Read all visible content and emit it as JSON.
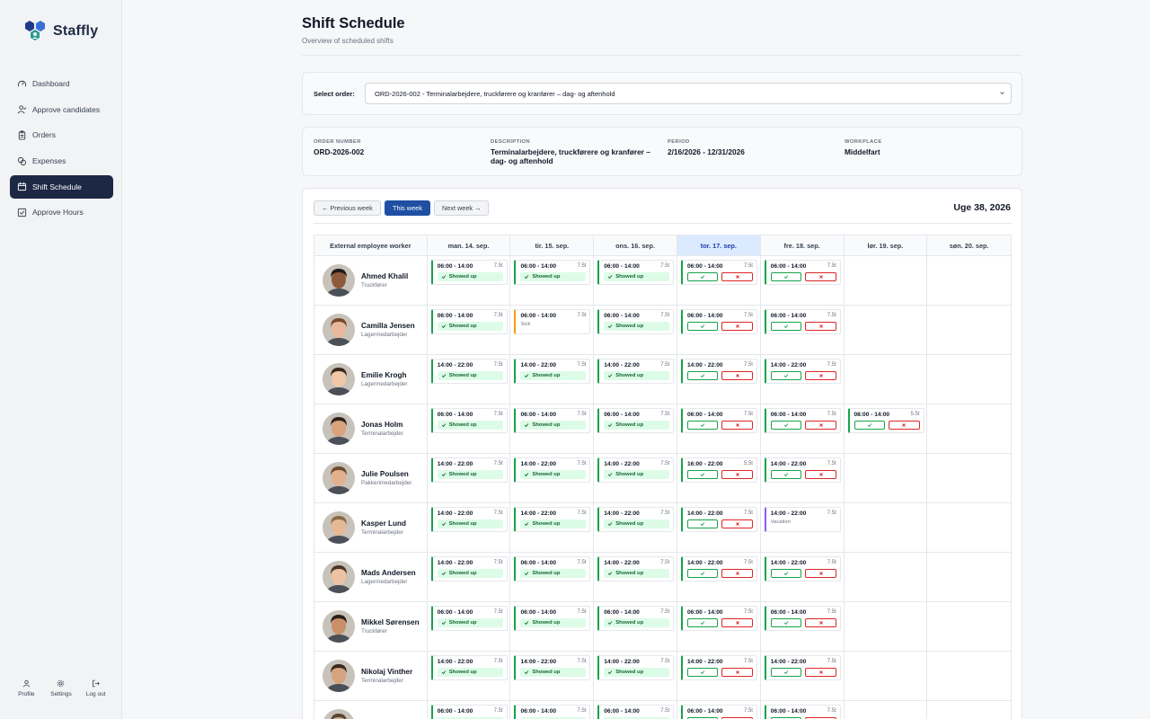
{
  "app": {
    "name": "Staffly"
  },
  "sidebar": {
    "items": [
      {
        "label": "Dashboard",
        "icon": "gauge-icon",
        "active": false
      },
      {
        "label": "Approve candidates",
        "icon": "user-check-icon",
        "active": false
      },
      {
        "label": "Orders",
        "icon": "clipboard-icon",
        "active": false
      },
      {
        "label": "Expenses",
        "icon": "coins-icon",
        "active": false
      },
      {
        "label": "Shift Schedule",
        "icon": "calendar-icon",
        "active": true
      },
      {
        "label": "Approve Hours",
        "icon": "check-square-icon",
        "active": false
      }
    ],
    "bottom": [
      {
        "label": "Profile",
        "icon": "user-icon"
      },
      {
        "label": "Settings",
        "icon": "gear-icon"
      },
      {
        "label": "Log out",
        "icon": "logout-icon"
      }
    ]
  },
  "page": {
    "title": "Shift Schedule",
    "subtitle": "Overview of scheduled shifts"
  },
  "order_select": {
    "label": "Select order:",
    "value": "ORD-2026-002 - Terminalarbejdere, truckførere og kranfører – dag- og aftenhold"
  },
  "order_info": {
    "number_label": "ORDER NUMBER",
    "number": "ORD-2026-002",
    "description_label": "DESCRIPTION",
    "description_line1": "Terminalarbejdere, truckførere og kranfører –",
    "description_line2": "dag- og aftenhold",
    "period_label": "PERIOD",
    "period": "2/16/2026 - 12/31/2026",
    "workplace_label": "WORKPLACE",
    "workplace": "Middelfart"
  },
  "week_nav": {
    "prev": "← Previous week",
    "this": "This week",
    "next": "Next week →",
    "title": "Uge 38, 2026"
  },
  "schedule": {
    "employee_header": "External employee worker",
    "days": [
      "man. 14. sep.",
      "tir. 15. sep.",
      "ons. 16. sep.",
      "tor. 17. sep.",
      "fre. 18. sep.",
      "lør. 19. sep.",
      "søn. 20. sep."
    ],
    "today_index": 3,
    "status_showed_up": "Showed up",
    "status_sick": "Sick",
    "status_vacation": "Vacation",
    "employees": [
      {
        "name": "Ahmed Khalil",
        "role": "Truckfører",
        "skin": "#8d5a3c",
        "hair": "#1f1a17",
        "shifts": [
          {
            "time": "06:00 - 14:00",
            "hours": "7.5t",
            "state": "showed"
          },
          {
            "time": "06:00 - 14:00",
            "hours": "7.5t",
            "state": "showed"
          },
          {
            "time": "06:00 - 14:00",
            "hours": "7.5t",
            "state": "showed"
          },
          {
            "time": "06:00 - 14:00",
            "hours": "7.5t",
            "state": "pending"
          },
          {
            "time": "06:00 - 14:00",
            "hours": "7.5t",
            "state": "pending"
          },
          null,
          null
        ]
      },
      {
        "name": "Camilla Jensen",
        "role": "Lagermedarbejder",
        "skin": "#e8b89a",
        "hair": "#7a4a2a",
        "shifts": [
          {
            "time": "06:00 - 14:00",
            "hours": "7.5t",
            "state": "showed"
          },
          {
            "time": "06:00 - 14:00",
            "hours": "7.5t",
            "state": "sick"
          },
          {
            "time": "06:00 - 14:00",
            "hours": "7.5t",
            "state": "showed"
          },
          {
            "time": "06:00 - 14:00",
            "hours": "7.5t",
            "state": "pending"
          },
          {
            "time": "06:00 - 14:00",
            "hours": "7.5t",
            "state": "pending"
          },
          null,
          null
        ]
      },
      {
        "name": "Emilie Krogh",
        "role": "Lagermedarbejder",
        "skin": "#f0c8a8",
        "hair": "#3b2a20",
        "shifts": [
          {
            "time": "14:00 - 22:00",
            "hours": "7.5t",
            "state": "showed"
          },
          {
            "time": "14:00 - 22:00",
            "hours": "7.5t",
            "state": "showed"
          },
          {
            "time": "14:00 - 22:00",
            "hours": "7.5t",
            "state": "showed"
          },
          {
            "time": "14:00 - 22:00",
            "hours": "7.5t",
            "state": "pending"
          },
          {
            "time": "14:00 - 22:00",
            "hours": "7.5t",
            "state": "pending"
          },
          null,
          null
        ]
      },
      {
        "name": "Jonas Holm",
        "role": "Terminalarbejder",
        "skin": "#d9a27c",
        "hair": "#2e2219",
        "shifts": [
          {
            "time": "06:00 - 14:00",
            "hours": "7.5t",
            "state": "showed"
          },
          {
            "time": "06:00 - 14:00",
            "hours": "7.5t",
            "state": "showed"
          },
          {
            "time": "06:00 - 14:00",
            "hours": "7.5t",
            "state": "showed"
          },
          {
            "time": "06:00 - 14:00",
            "hours": "7.5t",
            "state": "pending"
          },
          {
            "time": "06:00 - 14:00",
            "hours": "7.5t",
            "state": "pending"
          },
          {
            "time": "08:00 - 14:00",
            "hours": "5.5t",
            "state": "pending"
          },
          null
        ]
      },
      {
        "name": "Julie Poulsen",
        "role": "Pakkerimedarbejder",
        "skin": "#e3b08e",
        "hair": "#6b4a2b",
        "shifts": [
          {
            "time": "14:00 - 22:00",
            "hours": "7.5t",
            "state": "showed"
          },
          {
            "time": "14:00 - 22:00",
            "hours": "7.5t",
            "state": "showed"
          },
          {
            "time": "14:00 - 22:00",
            "hours": "7.5t",
            "state": "showed"
          },
          {
            "time": "16:00 - 22:00",
            "hours": "5.5t",
            "state": "pending"
          },
          {
            "time": "14:00 - 22:00",
            "hours": "7.5t",
            "state": "pending"
          },
          null,
          null
        ]
      },
      {
        "name": "Kasper Lund",
        "role": "Terminalarbejder",
        "skin": "#e6b896",
        "hair": "#8a6a45",
        "shifts": [
          {
            "time": "14:00 - 22:00",
            "hours": "7.5t",
            "state": "showed"
          },
          {
            "time": "14:00 - 22:00",
            "hours": "7.5t",
            "state": "showed"
          },
          {
            "time": "14:00 - 22:00",
            "hours": "7.5t",
            "state": "showed"
          },
          {
            "time": "14:00 - 22:00",
            "hours": "7.5t",
            "state": "pending"
          },
          {
            "time": "14:00 - 22:00",
            "hours": "7.5t",
            "state": "vacation"
          },
          null,
          null
        ]
      },
      {
        "name": "Mads Andersen",
        "role": "Lagermedarbejder",
        "skin": "#ecc2a2",
        "hair": "#4a3526",
        "shifts": [
          {
            "time": "14:00 - 22:00",
            "hours": "7.5t",
            "state": "showed"
          },
          {
            "time": "06:00 - 14:00",
            "hours": "7.5t",
            "state": "showed"
          },
          {
            "time": "14:00 - 22:00",
            "hours": "7.5t",
            "state": "showed"
          },
          {
            "time": "14:00 - 22:00",
            "hours": "7.5t",
            "state": "pending"
          },
          {
            "time": "14:00 - 22:00",
            "hours": "7.5t",
            "state": "pending"
          },
          null,
          null
        ]
      },
      {
        "name": "Mikkel Sørensen",
        "role": "Truckfører",
        "skin": "#c98f68",
        "hair": "#2a1f18",
        "shifts": [
          {
            "time": "06:00 - 14:00",
            "hours": "7.5t",
            "state": "showed"
          },
          {
            "time": "06:00 - 14:00",
            "hours": "7.5t",
            "state": "showed"
          },
          {
            "time": "06:00 - 14:00",
            "hours": "7.5t",
            "state": "showed"
          },
          {
            "time": "06:00 - 14:00",
            "hours": "7.5t",
            "state": "pending"
          },
          {
            "time": "06:00 - 14:00",
            "hours": "7.5t",
            "state": "pending"
          },
          null,
          null
        ]
      },
      {
        "name": "Nikolaj Vinther",
        "role": "Terminalarbejder",
        "skin": "#d7a27e",
        "hair": "#3a2a1f",
        "shifts": [
          {
            "time": "14:00 - 22:00",
            "hours": "7.5t",
            "state": "showed"
          },
          {
            "time": "14:00 - 22:00",
            "hours": "7.5t",
            "state": "showed"
          },
          {
            "time": "14:00 - 22:00",
            "hours": "7.5t",
            "state": "showed"
          },
          {
            "time": "14:00 - 22:00",
            "hours": "7.5t",
            "state": "pending"
          },
          {
            "time": "14:00 - 22:00",
            "hours": "7.5t",
            "state": "pending"
          },
          null,
          null
        ]
      },
      {
        "name": "",
        "role": "",
        "skin": "#cfae8e",
        "hair": "#5a4636",
        "shifts": [
          {
            "time": "06:00 - 14:00",
            "hours": "7.5t",
            "state": "showed"
          },
          {
            "time": "06:00 - 14:00",
            "hours": "7.5t",
            "state": "showed"
          },
          {
            "time": "06:00 - 14:00",
            "hours": "7.5t",
            "state": "showed"
          },
          {
            "time": "06:00 - 14:00",
            "hours": "7.5t",
            "state": "pending"
          },
          {
            "time": "06:00 - 14:00",
            "hours": "7.5t",
            "state": "pending"
          },
          null,
          null
        ]
      }
    ]
  }
}
